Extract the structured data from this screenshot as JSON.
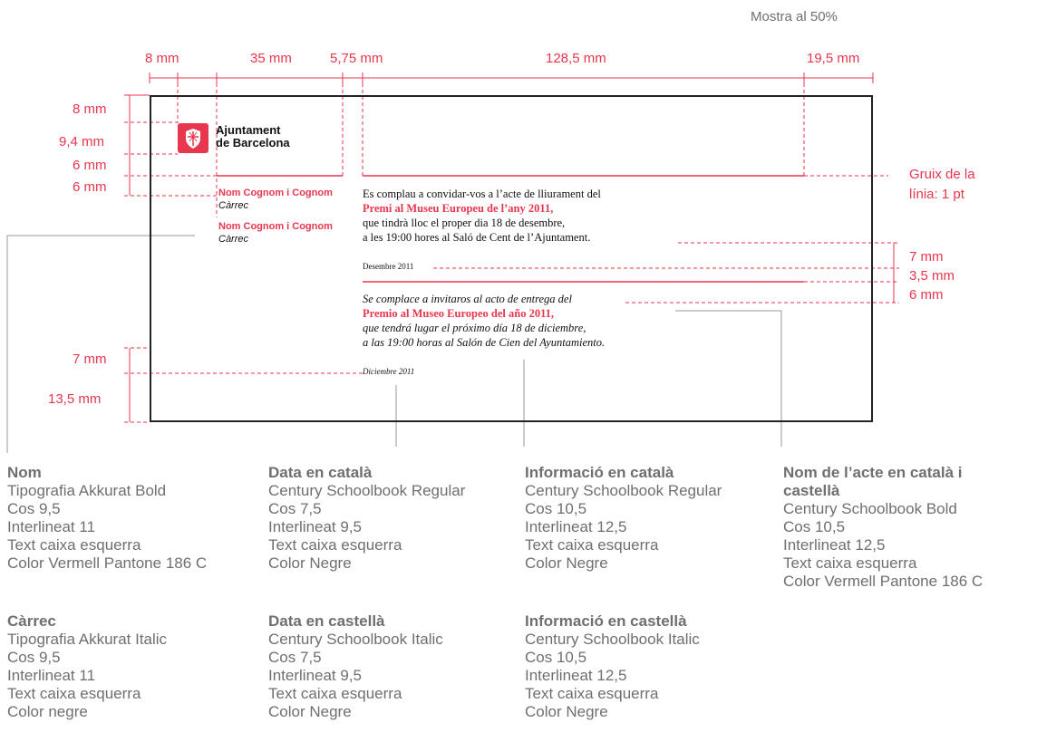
{
  "sample_note": "Mostra al 50%",
  "top_dims": [
    "8 mm",
    "35 mm",
    "5,75 mm",
    "128,5 mm",
    "19,5 mm"
  ],
  "left_dims": [
    "8 mm",
    "9,4 mm",
    "6 mm",
    "6 mm",
    "7 mm",
    "13,5 mm"
  ],
  "right_dims": [
    "7 mm",
    "3,5 mm",
    "6 mm"
  ],
  "line_weight": [
    "Gruix de la",
    "línia: 1 pt"
  ],
  "logo": {
    "line1": "Ajuntament",
    "line2": "de Barcelona",
    "mark": "shield-icon"
  },
  "signatories": [
    {
      "name": "Nom Cognom i Cognom",
      "role": "Càrrec"
    },
    {
      "name": "Nom Cognom i Cognom",
      "role": "Càrrec"
    }
  ],
  "catalan": {
    "l1": "Es complau a convidar-vos a l’acte de lliurament del",
    "l2": "Premi al Museu Europeu de l’any 2011,",
    "l3": "que tindrà lloc el proper dia 18 de desembre,",
    "l4": "a les 19:00 hores al Saló de Cent de l’Ajuntament.",
    "date": "Desembre 2011"
  },
  "spanish": {
    "l1": "Se complace a invitaros al acto de entrega del",
    "l2": "Premio al Museo Europeo del año 2011,",
    "l3": "que tendrá lugar el próximo día 18 de diciembre,",
    "l4": "a las 19:00 horas al Salón de Cien del Ayuntamiento.",
    "date": "Diciembre 2011"
  },
  "specs": {
    "nom": {
      "title": "Nom",
      "lines": [
        "Tipografia Akkurat Bold",
        "Cos 9,5",
        "Interlineat 11",
        "Text caixa esquerra",
        "Color Vermell Pantone 186 C"
      ]
    },
    "carrec": {
      "title": "Càrrec",
      "lines": [
        "Tipografia Akkurat Italic",
        "Cos 9,5",
        "Interlineat 11",
        "Text caixa esquerra",
        "Color negre"
      ]
    },
    "data_cat": {
      "title": "Data en català",
      "lines": [
        "Century Schoolbook Regular",
        "Cos 7,5",
        "Interlineat 9,5",
        "Text caixa esquerra",
        "Color Negre"
      ]
    },
    "data_cast": {
      "title": "Data en castellà",
      "lines": [
        "Century Schoolbook Italic",
        "Cos 7,5",
        "Interlineat 9,5",
        "Text caixa esquerra",
        "Color Negre"
      ]
    },
    "info_cat": {
      "title": "Informació en català",
      "lines": [
        "Century Schoolbook Regular",
        "Cos 10,5",
        "Interlineat 12,5",
        "Text caixa esquerra",
        "Color Negre"
      ]
    },
    "info_cast": {
      "title": "Informació en castellà",
      "lines": [
        "Century Schoolbook Italic",
        "Cos 10,5",
        "Interlineat 12,5",
        "Text caixa esquerra",
        "Color Negre"
      ]
    },
    "acte": {
      "title1": "Nom de l’acte en català i",
      "title2": "castellà",
      "lines": [
        "Century Schoolbook Bold",
        "Cos 10,5",
        "Interlineat 12,5",
        "Text caixa esquerra",
        "Color Vermell Pantone 186 C"
      ]
    }
  },
  "colors": {
    "accent": "#e8364f",
    "text": "#6f6f6f",
    "border": "#222222"
  }
}
